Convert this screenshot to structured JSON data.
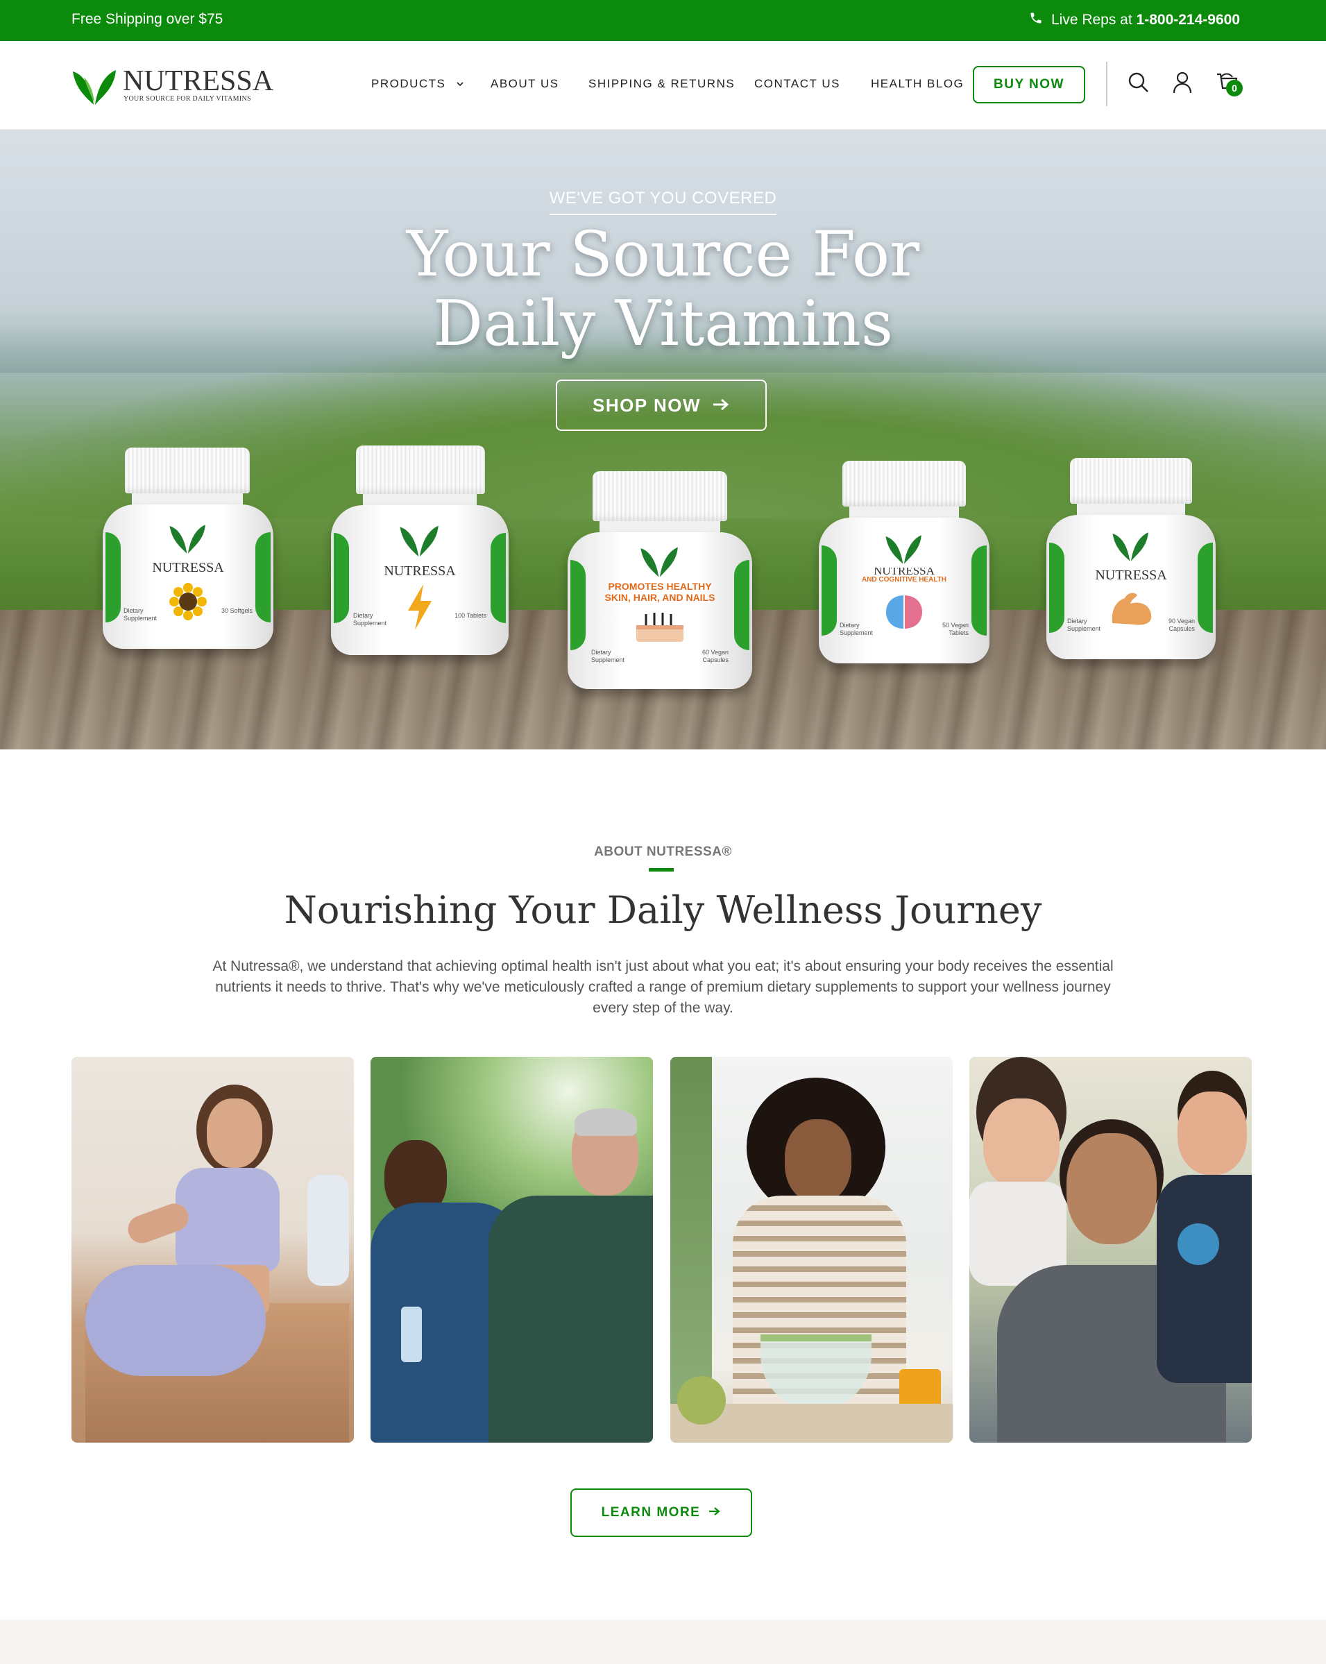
{
  "announcement": {
    "shipping": "Free Shipping over $75",
    "phone_prefix": "Live Reps at ",
    "phone_number": "1-800-214-9600"
  },
  "brand": {
    "name": "NUTRESSA",
    "tagline": "YOUR SOURCE FOR DAILY VITAMINS",
    "primary_color": "#0b8a0b"
  },
  "nav": {
    "items": [
      "PRODUCTS",
      "ABOUT US",
      "SHIPPING & RETURNS",
      "CONTACT US",
      "HEALTH BLOG"
    ],
    "buy_label": "BUY NOW",
    "cart_count": "0",
    "icons": [
      "search-icon",
      "account-icon",
      "cart-icon"
    ]
  },
  "hero": {
    "eyebrow": "WE'VE GOT YOU COVERED",
    "title_line1": "Your Source For",
    "title_line2": "Daily Vitamins",
    "cta": "SHOP NOW",
    "bottles": [
      {
        "brand": "NUTRESSA",
        "left_label": "Dietary Supplement",
        "right_label": "30 Softgels",
        "icon": "sunflower-icon"
      },
      {
        "brand": "NUTRESSA",
        "left_label": "Dietary Supplement",
        "right_label": "100 Tablets",
        "icon": "lightning-icon"
      },
      {
        "brand": "",
        "claim": "PROMOTES HEALTHY SKIN, HAIR, AND NAILS",
        "left_label": "Dietary Supplement",
        "right_label": "60 Vegan Capsules",
        "icon": "hair-icon"
      },
      {
        "brand": "NUTRESSA",
        "claim": "AND COGNITIVE HEALTH",
        "left_label": "Dietary Supplement",
        "right_label": "50 Vegan Tablets",
        "icon": "brain-icon"
      },
      {
        "brand": "NUTRESSA",
        "left_label": "Dietary Supplement",
        "right_label": "90 Vegan Capsules",
        "icon": "muscle-icon"
      }
    ]
  },
  "about": {
    "eyebrow": "ABOUT NUTRESSA®",
    "title": "Nourishing Your Daily Wellness Journey",
    "body": "At Nutressa®, we understand that achieving optimal health isn't just about what you eat; it's about ensuring your body receives the essential nutrients it needs to thrive. That's why we've meticulously crafted a range of premium dietary supplements to support your wellness journey every step of the way.",
    "cta": "LEARN MORE"
  }
}
